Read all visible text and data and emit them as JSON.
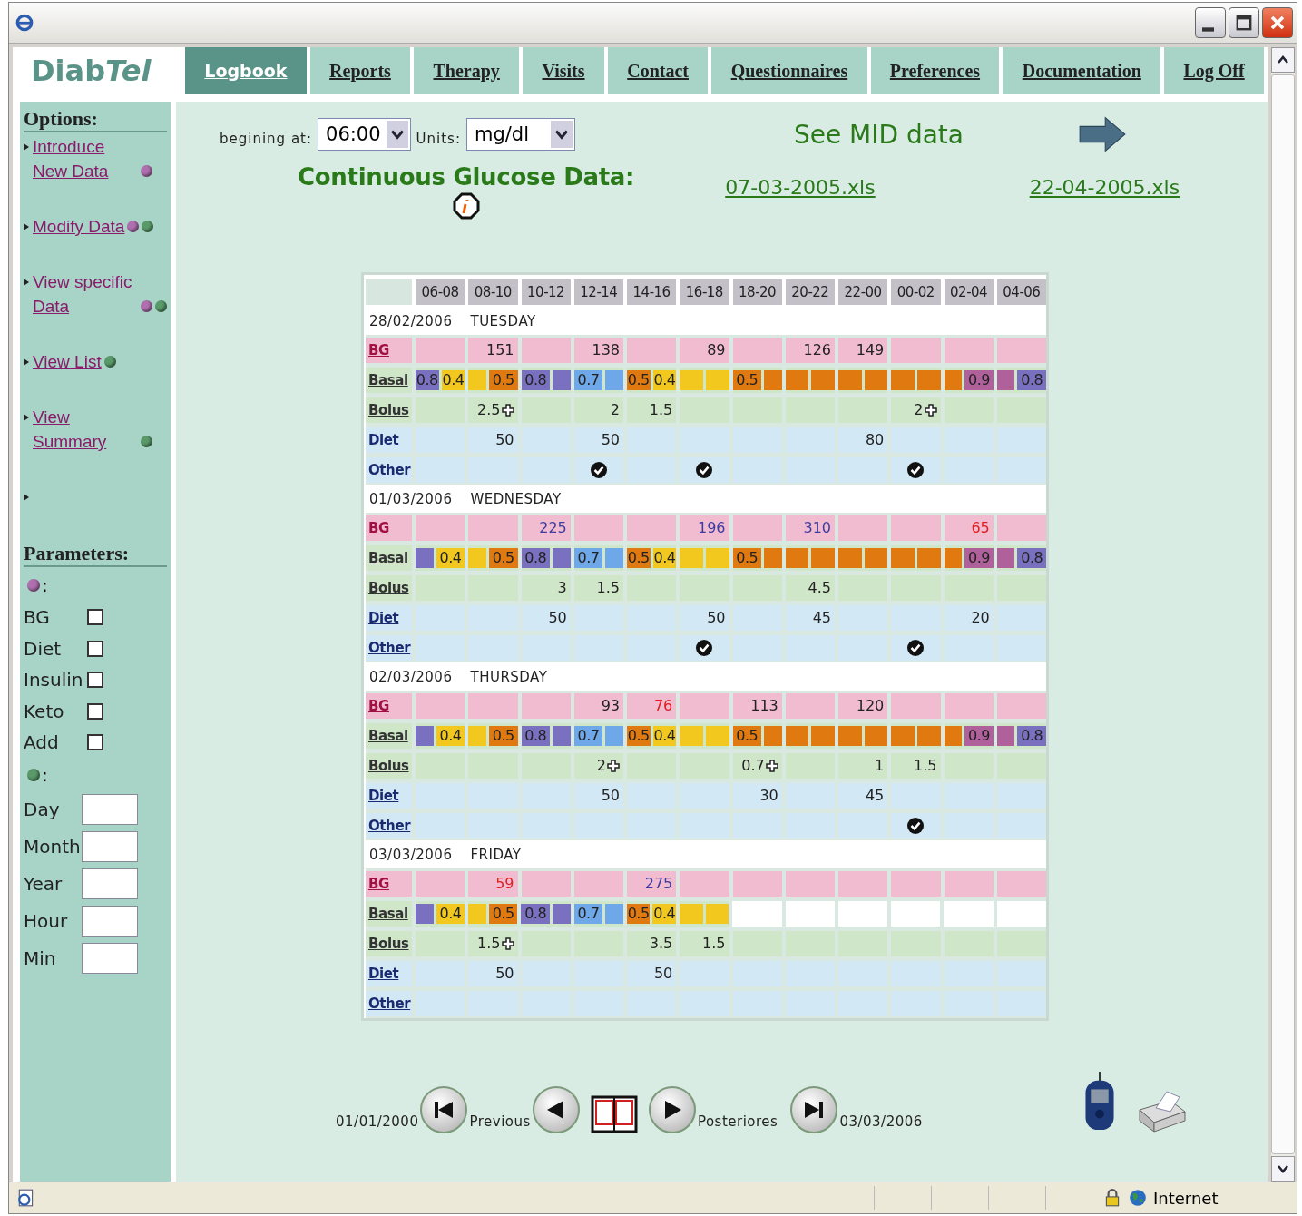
{
  "nav": {
    "logo": {
      "plain": "Diab",
      "italic": "Tel"
    },
    "tabs": [
      {
        "label": "Logbook",
        "selected": true
      },
      {
        "label": "Reports",
        "selected": false
      },
      {
        "label": "Therapy",
        "selected": false
      },
      {
        "label": "Visits",
        "selected": false
      },
      {
        "label": "Contact",
        "selected": false
      },
      {
        "label": "Questionnaires",
        "selected": false
      },
      {
        "label": "Preferences",
        "selected": false
      },
      {
        "label": "Documentation",
        "selected": false
      },
      {
        "label": "Log Off",
        "selected": false
      }
    ]
  },
  "sidebar": {
    "options_title": "Options:",
    "options": [
      {
        "text": "Introduce New Data",
        "dots": [
          {
            "color": "#b070b0"
          }
        ]
      },
      {
        "text": "Modify Data",
        "dots": [
          {
            "color": "#b070b0"
          },
          {
            "color": "#5a9a6a"
          }
        ]
      },
      {
        "text": "View specific Data",
        "dots": [
          {
            "color": "#b070b0"
          },
          {
            "color": "#5a9a6a"
          }
        ]
      },
      {
        "text": "View List",
        "dots": [
          {
            "color": "#5a9a6a"
          }
        ]
      },
      {
        "text": "View Summary",
        "dots": [
          {
            "color": "#5a9a6a"
          }
        ]
      }
    ],
    "parameters_title": "Parameters:",
    "checks_dot": {
      "color": "#b070b0",
      "suffix": ":"
    },
    "checks": [
      {
        "label": "BG",
        "checked": false
      },
      {
        "label": "Diet",
        "checked": false
      },
      {
        "label": "Insulin",
        "checked": false
      },
      {
        "label": "Keto",
        "checked": false
      },
      {
        "label": "Add",
        "checked": false
      }
    ],
    "fields_dot": {
      "color": "#5a9a6a",
      "suffix": ":"
    },
    "fields": [
      {
        "label": "Day"
      },
      {
        "label": "Month"
      },
      {
        "label": "Year"
      },
      {
        "label": "Hour"
      },
      {
        "label": "Min"
      }
    ]
  },
  "controls": {
    "start_label": "begining at:",
    "start_value": "06:00",
    "units_label": "Units:",
    "units_value": "mg/dl",
    "mid_link": "See MID data",
    "cgm_title": "Continuous Glucose Data:",
    "files": [
      "07-03-2005.xls",
      "22-04-2005.xls"
    ]
  },
  "table": {
    "columns": [
      "06-08",
      "08-10",
      "10-12",
      "12-14",
      "14-16",
      "16-18",
      "18-20",
      "20-22",
      "22-00",
      "00-02",
      "02-04",
      "04-06"
    ],
    "days": [
      {
        "date": "28/02/2006",
        "weekday": "TUESDAY",
        "labels": [
          "BG",
          "Basal",
          "Bolus",
          "Diet",
          "Other"
        ],
        "bg": [
          {
            "kind": "empty"
          },
          {
            "kind": "value",
            "value": "151",
            "color": "#222222"
          },
          {
            "kind": "empty"
          },
          {
            "kind": "value",
            "value": "138",
            "color": "#222222"
          },
          {
            "kind": "empty"
          },
          {
            "kind": "value",
            "value": "89",
            "color": "#222222"
          },
          {
            "kind": "empty"
          },
          {
            "kind": "value",
            "value": "126",
            "color": "#222222"
          },
          {
            "kind": "value",
            "value": "149",
            "color": "#222222"
          },
          {
            "kind": "empty"
          },
          {
            "kind": "empty"
          },
          {
            "kind": "empty"
          }
        ],
        "basal": [
          {
            "kind": "split",
            "segments": [
              {
                "color": "#7a70c0",
                "text": "0.8"
              },
              {
                "color": "#f2c81e",
                "text": "0.4"
              }
            ]
          },
          {
            "kind": "split",
            "segments": [
              {
                "color": "#f2c81e"
              },
              {
                "color": "#e07a10",
                "text": "0.5"
              }
            ]
          },
          {
            "kind": "split",
            "segments": [
              {
                "color": "#7a70c0",
                "text": "0.8"
              },
              {
                "color": "#7a70c0"
              }
            ]
          },
          {
            "kind": "split",
            "segments": [
              {
                "color": "#6fa8e8",
                "text": "0.7"
              },
              {
                "color": "#6fa8e8"
              }
            ]
          },
          {
            "kind": "split",
            "segments": [
              {
                "color": "#e07a10",
                "text": "0.5"
              },
              {
                "color": "#f2c81e",
                "text": "0.4"
              }
            ]
          },
          {
            "kind": "split",
            "segments": [
              {
                "color": "#f2c81e"
              },
              {
                "color": "#f2c81e"
              }
            ]
          },
          {
            "kind": "split",
            "segments": [
              {
                "color": "#e07a10",
                "text": "0.5"
              },
              {
                "color": "#e07a10"
              }
            ]
          },
          {
            "kind": "split",
            "segments": [
              {
                "color": "#e07a10"
              },
              {
                "color": "#e07a10"
              }
            ]
          },
          {
            "kind": "split",
            "segments": [
              {
                "color": "#e07a10"
              },
              {
                "color": "#e07a10"
              }
            ]
          },
          {
            "kind": "split",
            "segments": [
              {
                "color": "#e07a10"
              },
              {
                "color": "#e07a10"
              }
            ]
          },
          {
            "kind": "split",
            "segments": [
              {
                "color": "#e07a10"
              },
              {
                "color": "#b0609a",
                "text": "0.9"
              }
            ]
          },
          {
            "kind": "split",
            "segments": [
              {
                "color": "#b0609a"
              },
              {
                "color": "#7a70c0",
                "text": "0.8"
              }
            ]
          }
        ],
        "bolus": [
          {
            "kind": "empty"
          },
          {
            "kind": "value",
            "value": "2.5",
            "plus": true
          },
          {
            "kind": "empty"
          },
          {
            "kind": "value",
            "value": "2",
            "plus": false
          },
          {
            "kind": "value",
            "value": "1.5",
            "plus": false
          },
          {
            "kind": "empty"
          },
          {
            "kind": "empty"
          },
          {
            "kind": "empty"
          },
          {
            "kind": "empty"
          },
          {
            "kind": "value",
            "value": "2",
            "plus": true
          },
          {
            "kind": "empty"
          },
          {
            "kind": "empty"
          }
        ],
        "diet": [
          {
            "kind": "empty"
          },
          {
            "kind": "value",
            "value": "50"
          },
          {
            "kind": "empty"
          },
          {
            "kind": "value",
            "value": "50"
          },
          {
            "kind": "empty"
          },
          {
            "kind": "empty"
          },
          {
            "kind": "empty"
          },
          {
            "kind": "empty"
          },
          {
            "kind": "value",
            "value": "80"
          },
          {
            "kind": "empty"
          },
          {
            "kind": "empty"
          },
          {
            "kind": "empty"
          }
        ],
        "other": [
          false,
          false,
          false,
          true,
          false,
          true,
          false,
          false,
          false,
          true,
          false,
          false
        ]
      },
      {
        "date": "01/03/2006",
        "weekday": "WEDNESDAY",
        "labels": [
          "BG",
          "Basal",
          "Bolus",
          "Diet",
          "Other"
        ],
        "bg": [
          {
            "kind": "empty"
          },
          {
            "kind": "empty"
          },
          {
            "kind": "value",
            "value": "225",
            "color": "#3c3ca0"
          },
          {
            "kind": "empty"
          },
          {
            "kind": "empty"
          },
          {
            "kind": "value",
            "value": "196",
            "color": "#3c3ca0"
          },
          {
            "kind": "empty"
          },
          {
            "kind": "value",
            "value": "310",
            "color": "#3c3ca0"
          },
          {
            "kind": "empty"
          },
          {
            "kind": "empty"
          },
          {
            "kind": "value",
            "value": "65",
            "color": "#e02020"
          },
          {
            "kind": "empty"
          }
        ],
        "basal": [
          {
            "kind": "split",
            "segments": [
              {
                "color": "#7a70c0"
              },
              {
                "color": "#f2c81e",
                "text": "0.4"
              }
            ]
          },
          {
            "kind": "split",
            "segments": [
              {
                "color": "#f2c81e"
              },
              {
                "color": "#e07a10",
                "text": "0.5"
              }
            ]
          },
          {
            "kind": "split",
            "segments": [
              {
                "color": "#7a70c0",
                "text": "0.8"
              },
              {
                "color": "#7a70c0"
              }
            ]
          },
          {
            "kind": "split",
            "segments": [
              {
                "color": "#6fa8e8",
                "text": "0.7"
              },
              {
                "color": "#6fa8e8"
              }
            ]
          },
          {
            "kind": "split",
            "segments": [
              {
                "color": "#e07a10",
                "text": "0.5"
              },
              {
                "color": "#f2c81e",
                "text": "0.4"
              }
            ]
          },
          {
            "kind": "split",
            "segments": [
              {
                "color": "#f2c81e"
              },
              {
                "color": "#f2c81e"
              }
            ]
          },
          {
            "kind": "split",
            "segments": [
              {
                "color": "#e07a10",
                "text": "0.5"
              },
              {
                "color": "#e07a10"
              }
            ]
          },
          {
            "kind": "split",
            "segments": [
              {
                "color": "#e07a10"
              },
              {
                "color": "#e07a10"
              }
            ]
          },
          {
            "kind": "split",
            "segments": [
              {
                "color": "#e07a10"
              },
              {
                "color": "#e07a10"
              }
            ]
          },
          {
            "kind": "split",
            "segments": [
              {
                "color": "#e07a10"
              },
              {
                "color": "#e07a10"
              }
            ]
          },
          {
            "kind": "split",
            "segments": [
              {
                "color": "#e07a10"
              },
              {
                "color": "#b0609a",
                "text": "0.9"
              }
            ]
          },
          {
            "kind": "split",
            "segments": [
              {
                "color": "#b0609a"
              },
              {
                "color": "#7a70c0",
                "text": "0.8"
              }
            ]
          }
        ],
        "bolus": [
          {
            "kind": "empty"
          },
          {
            "kind": "empty"
          },
          {
            "kind": "value",
            "value": "3",
            "plus": false
          },
          {
            "kind": "value",
            "value": "1.5",
            "plus": false
          },
          {
            "kind": "empty"
          },
          {
            "kind": "empty"
          },
          {
            "kind": "empty"
          },
          {
            "kind": "value",
            "value": "4.5",
            "plus": false
          },
          {
            "kind": "empty"
          },
          {
            "kind": "empty"
          },
          {
            "kind": "empty"
          },
          {
            "kind": "empty"
          }
        ],
        "diet": [
          {
            "kind": "empty"
          },
          {
            "kind": "empty"
          },
          {
            "kind": "value",
            "value": "50"
          },
          {
            "kind": "empty"
          },
          {
            "kind": "empty"
          },
          {
            "kind": "value",
            "value": "50"
          },
          {
            "kind": "empty"
          },
          {
            "kind": "value",
            "value": "45"
          },
          {
            "kind": "empty"
          },
          {
            "kind": "empty"
          },
          {
            "kind": "value",
            "value": "20"
          },
          {
            "kind": "empty"
          }
        ],
        "other": [
          false,
          false,
          false,
          false,
          false,
          true,
          false,
          false,
          false,
          true,
          false,
          false
        ]
      },
      {
        "date": "02/03/2006",
        "weekday": "THURSDAY",
        "labels": [
          "BG",
          "Basal",
          "Bolus",
          "Diet",
          "Other"
        ],
        "bg": [
          {
            "kind": "empty"
          },
          {
            "kind": "empty"
          },
          {
            "kind": "empty"
          },
          {
            "kind": "value",
            "value": "93",
            "color": "#222222"
          },
          {
            "kind": "value",
            "value": "76",
            "color": "#e02020"
          },
          {
            "kind": "empty"
          },
          {
            "kind": "value",
            "value": "113",
            "color": "#222222"
          },
          {
            "kind": "empty"
          },
          {
            "kind": "value",
            "value": "120",
            "color": "#222222"
          },
          {
            "kind": "empty"
          },
          {
            "kind": "empty"
          },
          {
            "kind": "empty"
          }
        ],
        "basal": [
          {
            "kind": "split",
            "segments": [
              {
                "color": "#7a70c0"
              },
              {
                "color": "#f2c81e",
                "text": "0.4"
              }
            ]
          },
          {
            "kind": "split",
            "segments": [
              {
                "color": "#f2c81e"
              },
              {
                "color": "#e07a10",
                "text": "0.5"
              }
            ]
          },
          {
            "kind": "split",
            "segments": [
              {
                "color": "#7a70c0",
                "text": "0.8"
              },
              {
                "color": "#7a70c0"
              }
            ]
          },
          {
            "kind": "split",
            "segments": [
              {
                "color": "#6fa8e8",
                "text": "0.7"
              },
              {
                "color": "#6fa8e8"
              }
            ]
          },
          {
            "kind": "split",
            "segments": [
              {
                "color": "#e07a10",
                "text": "0.5"
              },
              {
                "color": "#f2c81e",
                "text": "0.4"
              }
            ]
          },
          {
            "kind": "split",
            "segments": [
              {
                "color": "#f2c81e"
              },
              {
                "color": "#f2c81e"
              }
            ]
          },
          {
            "kind": "split",
            "segments": [
              {
                "color": "#e07a10",
                "text": "0.5"
              },
              {
                "color": "#e07a10"
              }
            ]
          },
          {
            "kind": "split",
            "segments": [
              {
                "color": "#e07a10"
              },
              {
                "color": "#e07a10"
              }
            ]
          },
          {
            "kind": "split",
            "segments": [
              {
                "color": "#e07a10"
              },
              {
                "color": "#e07a10"
              }
            ]
          },
          {
            "kind": "split",
            "segments": [
              {
                "color": "#e07a10"
              },
              {
                "color": "#e07a10"
              }
            ]
          },
          {
            "kind": "split",
            "segments": [
              {
                "color": "#e07a10"
              },
              {
                "color": "#b0609a",
                "text": "0.9"
              }
            ]
          },
          {
            "kind": "split",
            "segments": [
              {
                "color": "#b0609a"
              },
              {
                "color": "#7a70c0",
                "text": "0.8"
              }
            ]
          }
        ],
        "bolus": [
          {
            "kind": "empty"
          },
          {
            "kind": "empty"
          },
          {
            "kind": "empty"
          },
          {
            "kind": "value",
            "value": "2",
            "plus": true
          },
          {
            "kind": "empty"
          },
          {
            "kind": "empty"
          },
          {
            "kind": "value",
            "value": "0.7",
            "plus": true
          },
          {
            "kind": "empty"
          },
          {
            "kind": "value",
            "value": "1",
            "plus": false
          },
          {
            "kind": "value",
            "value": "1.5",
            "plus": false
          },
          {
            "kind": "empty"
          },
          {
            "kind": "empty"
          }
        ],
        "diet": [
          {
            "kind": "empty"
          },
          {
            "kind": "empty"
          },
          {
            "kind": "empty"
          },
          {
            "kind": "value",
            "value": "50"
          },
          {
            "kind": "empty"
          },
          {
            "kind": "empty"
          },
          {
            "kind": "value",
            "value": "30"
          },
          {
            "kind": "empty"
          },
          {
            "kind": "value",
            "value": "45"
          },
          {
            "kind": "empty"
          },
          {
            "kind": "empty"
          },
          {
            "kind": "empty"
          }
        ],
        "other": [
          false,
          false,
          false,
          false,
          false,
          false,
          false,
          false,
          false,
          true,
          false,
          false
        ]
      },
      {
        "date": "03/03/2006",
        "weekday": "FRIDAY",
        "labels": [
          "BG",
          "Basal",
          "Bolus",
          "Diet",
          "Other"
        ],
        "bg": [
          {
            "kind": "empty"
          },
          {
            "kind": "value",
            "value": "59",
            "color": "#e02020"
          },
          {
            "kind": "empty"
          },
          {
            "kind": "empty"
          },
          {
            "kind": "value",
            "value": "275",
            "color": "#3c3ca0"
          },
          {
            "kind": "empty"
          },
          {
            "kind": "empty"
          },
          {
            "kind": "empty"
          },
          {
            "kind": "empty"
          },
          {
            "kind": "empty"
          },
          {
            "kind": "empty"
          },
          {
            "kind": "empty"
          }
        ],
        "basal": [
          {
            "kind": "split",
            "segments": [
              {
                "color": "#7a70c0"
              },
              {
                "color": "#f2c81e",
                "text": "0.4"
              }
            ]
          },
          {
            "kind": "split",
            "segments": [
              {
                "color": "#f2c81e"
              },
              {
                "color": "#e07a10",
                "text": "0.5"
              }
            ]
          },
          {
            "kind": "split",
            "segments": [
              {
                "color": "#7a70c0",
                "text": "0.8"
              },
              {
                "color": "#7a70c0"
              }
            ]
          },
          {
            "kind": "split",
            "segments": [
              {
                "color": "#6fa8e8",
                "text": "0.7"
              },
              {
                "color": "#6fa8e8"
              }
            ]
          },
          {
            "kind": "split",
            "segments": [
              {
                "color": "#e07a10",
                "text": "0.5"
              },
              {
                "color": "#f2c81e",
                "text": "0.4"
              }
            ]
          },
          {
            "kind": "split",
            "segments": [
              {
                "color": "#f2c81e"
              },
              {
                "color": "#f2c81e"
              }
            ]
          },
          {
            "kind": "empty"
          },
          {
            "kind": "empty"
          },
          {
            "kind": "empty"
          },
          {
            "kind": "empty"
          },
          {
            "kind": "empty"
          },
          {
            "kind": "empty"
          }
        ],
        "bolus": [
          {
            "kind": "empty"
          },
          {
            "kind": "value",
            "value": "1.5",
            "plus": true
          },
          {
            "kind": "empty"
          },
          {
            "kind": "empty"
          },
          {
            "kind": "value",
            "value": "3.5",
            "plus": false
          },
          {
            "kind": "value",
            "value": "1.5",
            "plus": false
          },
          {
            "kind": "empty"
          },
          {
            "kind": "empty"
          },
          {
            "kind": "empty"
          },
          {
            "kind": "empty"
          },
          {
            "kind": "empty"
          },
          {
            "kind": "empty"
          }
        ],
        "diet": [
          {
            "kind": "empty"
          },
          {
            "kind": "value",
            "value": "50"
          },
          {
            "kind": "empty"
          },
          {
            "kind": "empty"
          },
          {
            "kind": "value",
            "value": "50"
          },
          {
            "kind": "empty"
          },
          {
            "kind": "empty"
          },
          {
            "kind": "empty"
          },
          {
            "kind": "empty"
          },
          {
            "kind": "empty"
          },
          {
            "kind": "empty"
          },
          {
            "kind": "empty"
          }
        ],
        "other": [
          false,
          false,
          false,
          false,
          false,
          false,
          false,
          false,
          false,
          false,
          false,
          false
        ]
      }
    ]
  },
  "pager": {
    "first_date": "01/01/2000",
    "previous": "Previous",
    "next": "Posteriores",
    "last_date": "03/03/2006"
  },
  "status_bar": {
    "zone": "Internet"
  }
}
